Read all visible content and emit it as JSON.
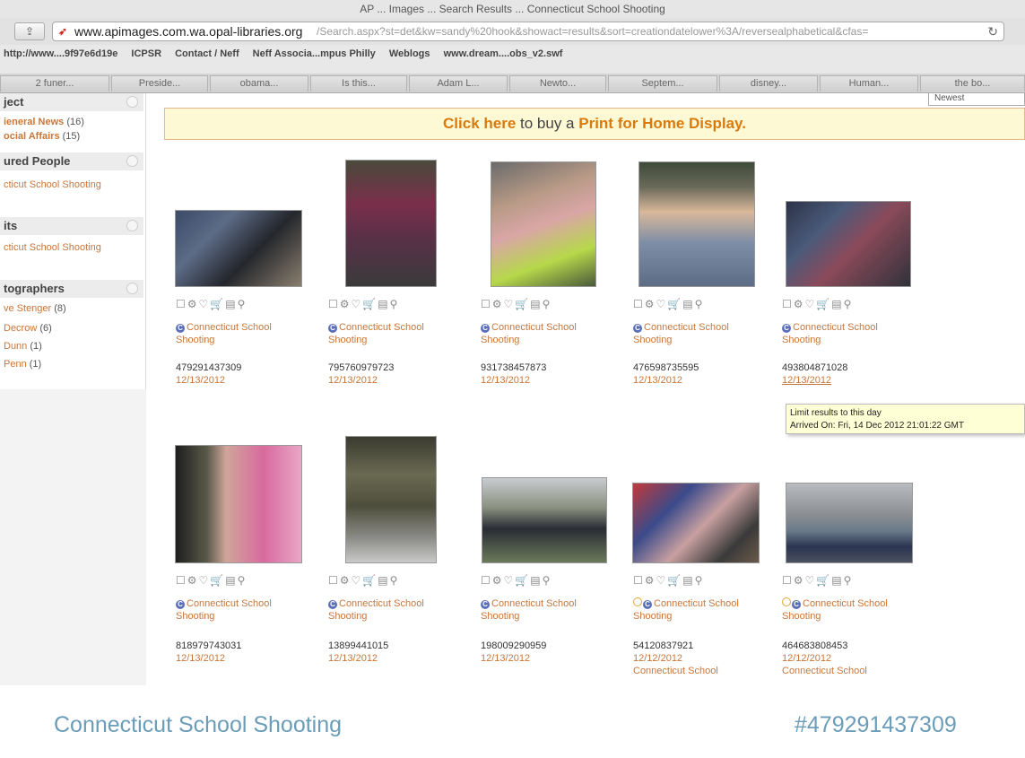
{
  "window": {
    "title": "AP ... Images ... Search Results ... Connecticut School Shooting"
  },
  "address_bar": {
    "host": "www.apimages.com.wa.opal-libraries.org",
    "path": "/Search.aspx?st=det&kw=sandy%20hook&showact=results&sort=creationdatelower%3A/reversealphabetical&cfas=",
    "share_icon": "share-icon",
    "reload_icon": "reload-icon"
  },
  "bookmarks": [
    "http://www....9f97e6d19e",
    "ICPSR",
    "Contact / Neff",
    "Neff Associa...mpus Philly",
    "Weblogs",
    "www.dream....obs_v2.swf"
  ],
  "tabs": [
    "2 funer...",
    "Preside...",
    "obama...",
    "Is this...",
    "Adam L...",
    "Newto...",
    "Septem...",
    "disney...",
    "Human...",
    "the bo..."
  ],
  "sidebar": {
    "sections": [
      {
        "heading": "ject",
        "items": [
          {
            "label": "ieneral News",
            "count": "(16)"
          },
          {
            "label": "ocial Affairs",
            "count": "(15)"
          }
        ]
      },
      {
        "heading": "ured People",
        "items": [
          {
            "label": "cticut School Shooting",
            "count": ""
          }
        ]
      },
      {
        "heading": "its",
        "items": [
          {
            "label": "cticut School Shooting",
            "count": ""
          }
        ]
      },
      {
        "heading": "tographers",
        "items": [
          {
            "label": "ve Stenger",
            "count": "(8)"
          },
          {
            "label": "Decrow",
            "count": "(6)"
          },
          {
            "label": "Dunn",
            "count": "(1)"
          },
          {
            "label": "Penn",
            "count": "(1)"
          }
        ]
      }
    ]
  },
  "sort": {
    "selected": "Newest"
  },
  "banner": {
    "link": "Click here",
    "middle": "to buy a",
    "product": "Print for Home Display."
  },
  "results": [
    {
      "title": "Connecticut School Shooting",
      "id": "479291437309",
      "date": "12/13/2012",
      "caption": ""
    },
    {
      "title": "Connecticut School Shooting",
      "id": "795760979723",
      "date": "12/13/2012",
      "caption": ""
    },
    {
      "title": "Connecticut School Shooting",
      "id": "931738457873",
      "date": "12/13/2012",
      "caption": ""
    },
    {
      "title": "Connecticut School Shooting",
      "id": "476598735595",
      "date": "12/13/2012",
      "caption": ""
    },
    {
      "title": "Connecticut School Shooting",
      "id": "493804871028",
      "date": "12/13/2012",
      "caption": ""
    },
    {
      "title": "Connecticut School Shooting",
      "id": "818979743031",
      "date": "12/13/2012",
      "caption": ""
    },
    {
      "title": "Connecticut School Shooting",
      "id": "13899441015",
      "date": "12/13/2012",
      "caption": ""
    },
    {
      "title": "Connecticut School Shooting",
      "id": "198009290959",
      "date": "12/13/2012",
      "caption": ""
    },
    {
      "title": "Connecticut School Shooting",
      "id": "54120837921",
      "date": "12/12/2012",
      "caption": "Connecticut School"
    },
    {
      "title": "Connecticut School Shooting",
      "id": "464683808453",
      "date": "12/12/2012",
      "caption": "Connecticut School"
    }
  ],
  "tool_icons": [
    "select-checkbox-icon",
    "gear-icon",
    "lightbox-icon",
    "cart-icon",
    "details-icon",
    "zoom-icon"
  ],
  "tooltip": {
    "line1": "Limit results to this day",
    "line2": "Arrived On: Fri, 14 Dec 2012 21:01:22 GMT"
  },
  "footer": {
    "title": "Connecticut School Shooting",
    "id": "#479291437309"
  }
}
